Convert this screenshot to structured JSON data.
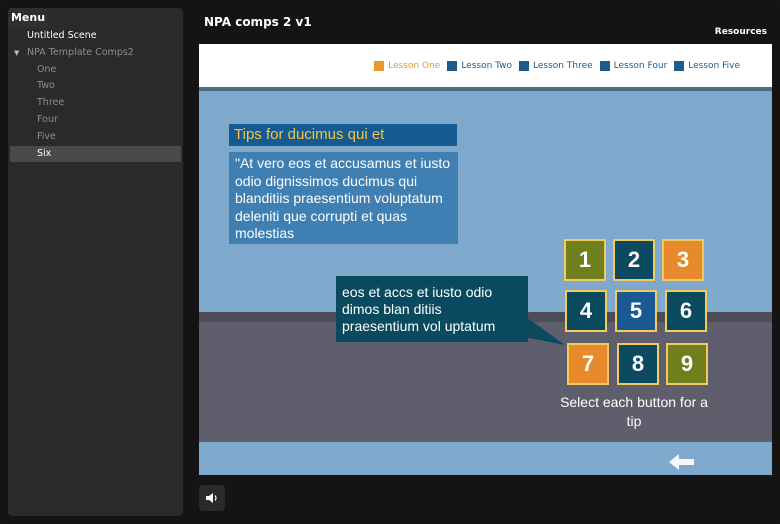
{
  "menu": {
    "tab_label": "Menu",
    "items": [
      {
        "label": "Untitled Scene",
        "level": 0
      },
      {
        "label": "NPA Template Comps2",
        "level": 1
      },
      {
        "label": "One",
        "level": 2
      },
      {
        "label": "Two",
        "level": 2
      },
      {
        "label": "Three",
        "level": 2
      },
      {
        "label": "Four",
        "level": 2
      },
      {
        "label": "Five",
        "level": 2
      },
      {
        "label": "Six",
        "level": 2,
        "selected": true
      }
    ]
  },
  "header": {
    "title": "NPA comps 2 v1",
    "resources_label": "Resources"
  },
  "slide": {
    "lessons": [
      {
        "label": "Lesson One",
        "active": true
      },
      {
        "label": "Lesson Two",
        "active": false
      },
      {
        "label": "Lesson Three",
        "active": false
      },
      {
        "label": "Lesson Four",
        "active": false
      },
      {
        "label": "Lesson Five",
        "active": false
      }
    ],
    "tips_title": "Tips for ducimus qui et",
    "tips_body": "\"At vero eos et accusamus et iusto odio dignissimos ducimus qui blanditiis praesentium voluptatum deleniti que corrupti et quas molestias",
    "callout_text": "eos et accs et iusto odio dimos blan ditiis praesentium vol uptatum",
    "buttons": [
      {
        "label": "1",
        "color": "#6f7f1e"
      },
      {
        "label": "2",
        "color": "#0c4a5f"
      },
      {
        "label": "3",
        "color": "#e68a2b"
      },
      {
        "label": "4",
        "color": "#0c4a5f"
      },
      {
        "label": "5",
        "color": "#1a5a94"
      },
      {
        "label": "6",
        "color": "#0c4a5f"
      },
      {
        "label": "7",
        "color": "#e68a2b"
      },
      {
        "label": "8",
        "color": "#0c4a5f"
      },
      {
        "label": "9",
        "color": "#6f7f1e"
      }
    ],
    "select_note": "Select each button for a tip"
  },
  "icons": {
    "collapse": "caret-down-icon",
    "back": "back-arrow-icon",
    "volume": "speaker-icon"
  }
}
